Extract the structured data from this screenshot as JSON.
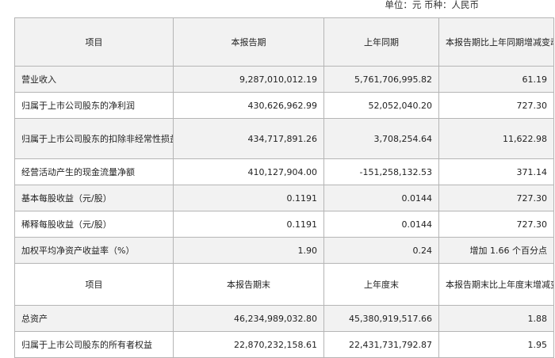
{
  "unit_line": "单位：元 币种：人民币",
  "header1": {
    "item": "项目",
    "current": "本报告期",
    "previous": "上年同期",
    "change": "本报告期比上年同期增减变动幅度(%)"
  },
  "rows1": [
    {
      "label": "营业收入",
      "current": "9,287,010,012.19",
      "previous": "5,761,706,995.82",
      "change": "61.19"
    },
    {
      "label": "归属于上市公司股东的净利润",
      "current": "430,626,962.99",
      "previous": "52,052,040.20",
      "change": "727.30"
    },
    {
      "label": "归属于上市公司股东的扣除非经常性损益的净利润",
      "current": "434,717,891.26",
      "previous": "3,708,254.64",
      "change": "11,622.98"
    },
    {
      "label": "经营活动产生的现金流量净额",
      "current": "410,127,904.00",
      "previous": "-151,258,132.53",
      "change": "371.14"
    },
    {
      "label": "基本每股收益（元/股）",
      "current": "0.1191",
      "previous": "0.0144",
      "change": "727.30"
    },
    {
      "label": "稀释每股收益（元/股）",
      "current": "0.1191",
      "previous": "0.0144",
      "change": "727.30"
    },
    {
      "label": "加权平均净资产收益率（%）",
      "current": "1.90",
      "previous": "0.24",
      "change": "增加 1.66 个百分点"
    }
  ],
  "header2": {
    "item": "项目",
    "current": "本报告期末",
    "previous": "上年度末",
    "change": "本报告期末比上年度末增减变动幅度(%)"
  },
  "rows2": [
    {
      "label": "总资产",
      "current": "46,234,989,032.80",
      "previous": "45,380,919,517.66",
      "change": "1.88"
    },
    {
      "label": "归属于上市公司股东的所有者权益",
      "current": "22,870,232,158.61",
      "previous": "22,431,731,792.87",
      "change": "1.95"
    }
  ]
}
